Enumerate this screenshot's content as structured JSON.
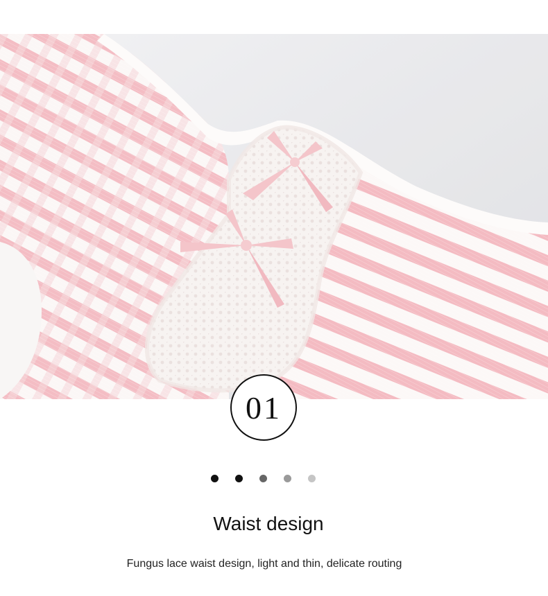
{
  "hero": {
    "alt": "Pink and white striped ribbed underwear waistband with lace and bows"
  },
  "badge": {
    "number": "01"
  },
  "pagination": {
    "dots": [
      {
        "color": "#111111"
      },
      {
        "color": "#111111"
      },
      {
        "color": "#666666"
      },
      {
        "color": "#9a9a9a"
      },
      {
        "color": "#c5c5c5"
      }
    ]
  },
  "section": {
    "title": "Waist design",
    "description": "Fungus lace waist design, light and thin, delicate routing"
  },
  "colors": {
    "stripe_pink": "#f3b8bf",
    "stripe_white": "#fbf7f6",
    "lace": "#f4f0ee",
    "bow": "#f2bfc5",
    "background": "#e8e8ea"
  }
}
